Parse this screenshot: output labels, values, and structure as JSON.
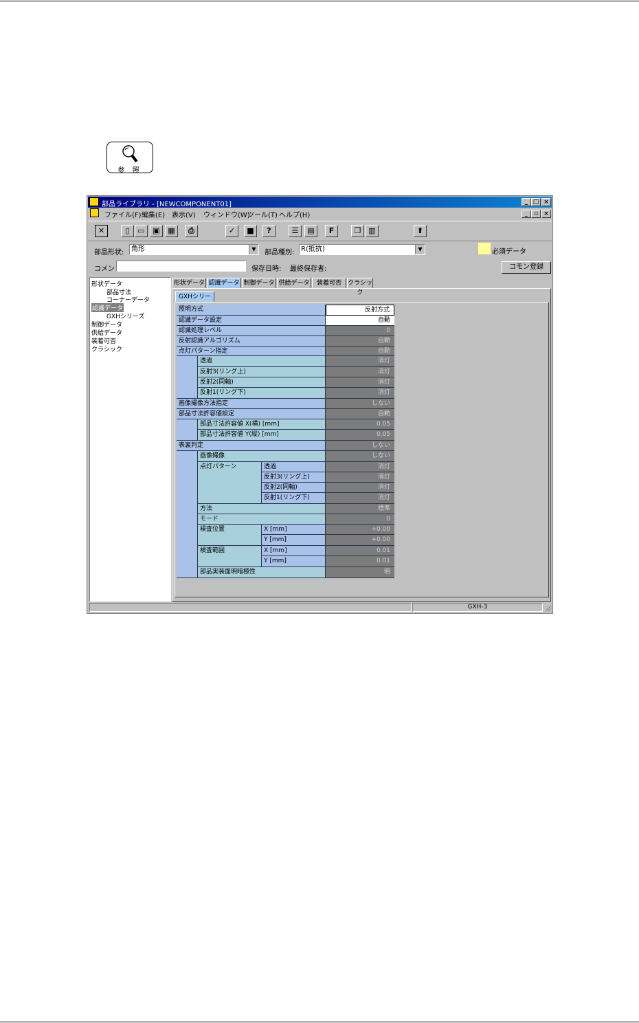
{
  "reference_label": "参 照",
  "window": {
    "title": "部品ライブラリ - [NEWCOMPONENT01]",
    "menu": [
      "ファイル(F)",
      "編集(E)",
      "表示(V)",
      "ウィンドウ(W)",
      "ツール(T)",
      "ヘルプ(H)"
    ]
  },
  "fields": {
    "shape_label": "部品形状:",
    "shape_value": "角形",
    "type_label": "部品種別:",
    "type_value": "R(抵抗)",
    "required_label": "必須データ",
    "comment_label": "コメント:",
    "comment_value": "",
    "saved_date_label": "保存日時:",
    "last_saver_label": "最終保存者:",
    "common_register": "コモン登録"
  },
  "tree": {
    "items": [
      "形状データ",
      "部品寸法",
      "コーナーデータ",
      "認識データ",
      "GXHシリーズ",
      "制御データ",
      "供給データ",
      "装着可否",
      "クラシック"
    ]
  },
  "tabs": [
    "形状データ",
    "認識データ",
    "制御データ",
    "供給データ",
    "装着可否",
    "クラシック"
  ],
  "subtab": "GXHシリーズ",
  "grid": {
    "rows": [
      {
        "label": "照明方式",
        "value": "反射方式"
      },
      {
        "label": "認識データ設定",
        "value": "自動"
      },
      {
        "label": "認識処理レベル",
        "value": "0"
      },
      {
        "label": "反射認識アルゴリズム",
        "value": "自動"
      },
      {
        "label": "点灯パターン指定",
        "value": "自動"
      },
      {
        "label": "透過",
        "value": "消灯"
      },
      {
        "label": "反射3(リング上)",
        "value": "消灯"
      },
      {
        "label": "反射2(同軸)",
        "value": "消灯"
      },
      {
        "label": "反射1(リング下)",
        "value": "消灯"
      },
      {
        "label": "画像撮像方法指定",
        "value": "しない"
      },
      {
        "label": "部品寸法許容値設定",
        "value": "自動"
      },
      {
        "label": "部品寸法許容値 X(横) [mm]",
        "value": "0.05"
      },
      {
        "label": "部品寸法許容値 Y(縦) [mm]",
        "value": "0.05"
      },
      {
        "label": "表裏判定",
        "value": "しない"
      },
      {
        "label": "画像撮像",
        "value": "しない"
      },
      {
        "label": "透過",
        "value": "消灯"
      },
      {
        "label": "反射3(リング上)",
        "value": "消灯"
      },
      {
        "label": "反射2(同軸)",
        "value": "消灯"
      },
      {
        "label": "反射1(リング下)",
        "value": "消灯"
      },
      {
        "label": "方法",
        "value": "標準"
      },
      {
        "label": "モード",
        "value": "0"
      },
      {
        "label": "X [mm]",
        "value": "+0.00"
      },
      {
        "label": "Y [mm]",
        "value": "+0.00"
      },
      {
        "label": "X [mm]",
        "value": "0.01"
      },
      {
        "label": "Y [mm]",
        "value": "0.01"
      },
      {
        "label": "部品実装面明暗極性",
        "value": "明"
      }
    ],
    "groups": {
      "lighting_pattern": "点灯パターン",
      "inspect_position": "検査位置",
      "inspect_range": "検査範囲"
    }
  },
  "status": {
    "model": "GXH-3"
  }
}
